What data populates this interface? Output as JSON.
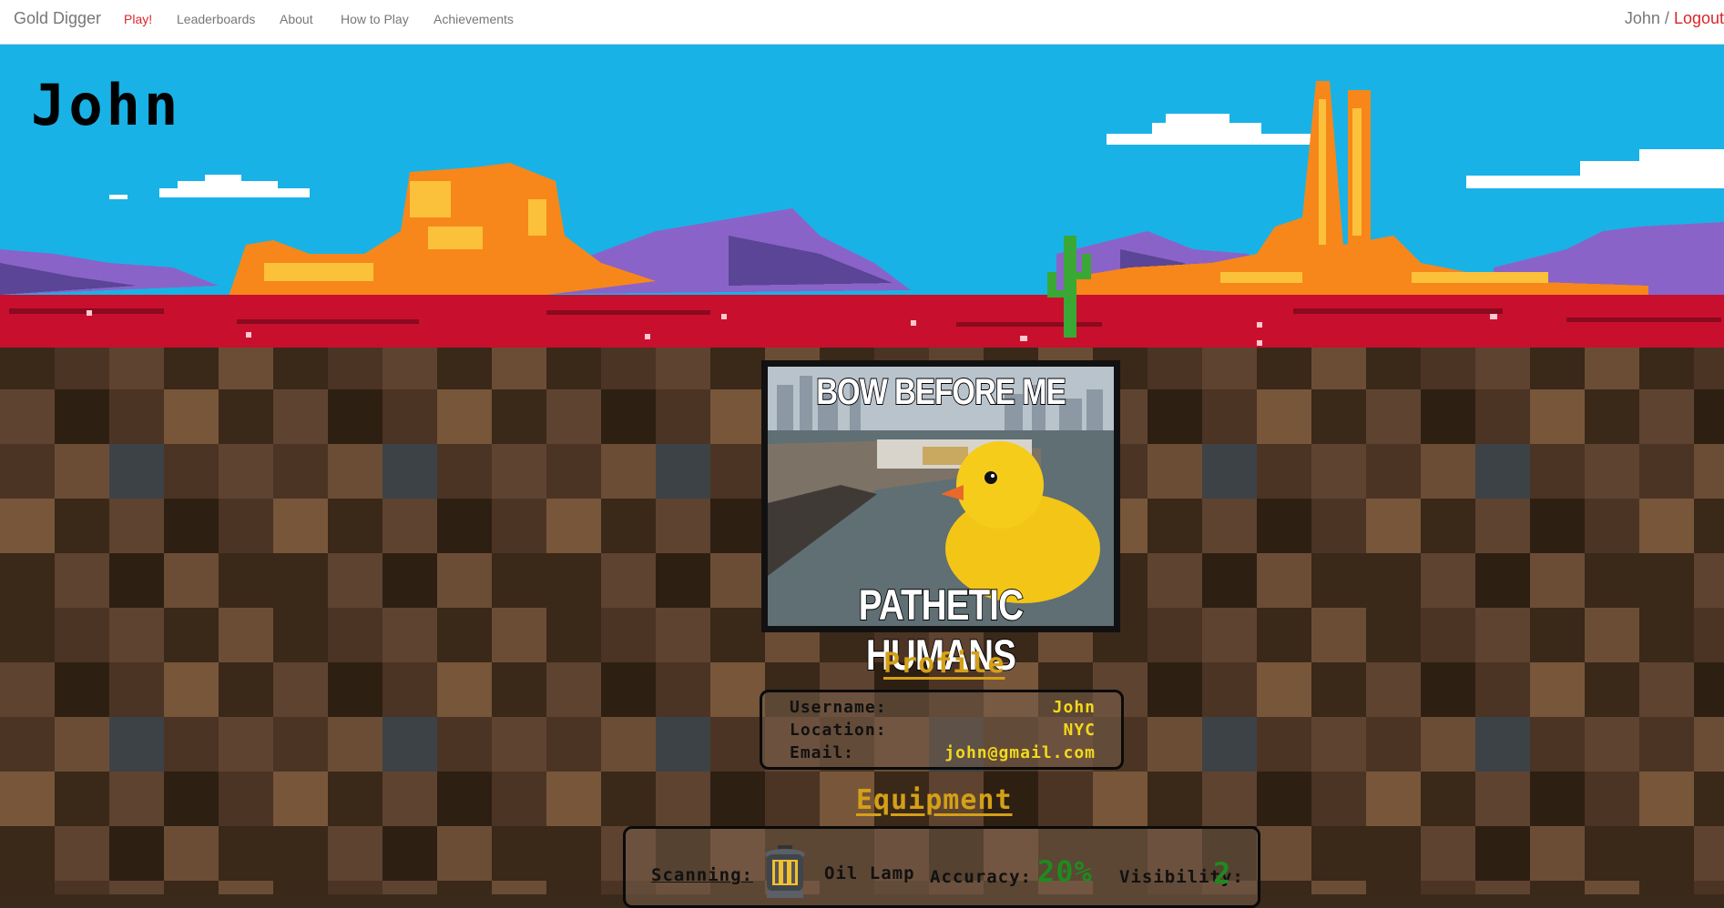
{
  "nav": {
    "brand": "Gold Digger",
    "links": [
      "Play!",
      "Leaderboards",
      "About",
      "How to Play",
      "Achievements"
    ],
    "user": "John",
    "separator": " / ",
    "logout": "Logout"
  },
  "hero": {
    "title": "John"
  },
  "meme": {
    "top_text": "BOW BEFORE ME",
    "bottom_text": "PATHETIC HUMANS"
  },
  "profile": {
    "heading": "Profile",
    "rows": [
      {
        "label": "Username:",
        "value": "John"
      },
      {
        "label": "Location:",
        "value": "NYC"
      },
      {
        "label": "Email:",
        "value": "john@gmail.com"
      }
    ]
  },
  "equipment": {
    "heading": "Equipment",
    "scanning_label": "Scanning:",
    "item_name": "Oil Lamp",
    "accuracy_label": "Accuracy:",
    "accuracy_value": "20%",
    "visibility_label": "Visibility:",
    "visibility_value": "2",
    "icon": "oil-lamp-icon"
  },
  "colors": {
    "accent_red": "#d9262a",
    "gold": "#d4a017",
    "value_yellow": "#f2d91b",
    "sky": "#19b2e6",
    "ground_red": "#c8102e",
    "stat_green": "#1f8a1f"
  }
}
